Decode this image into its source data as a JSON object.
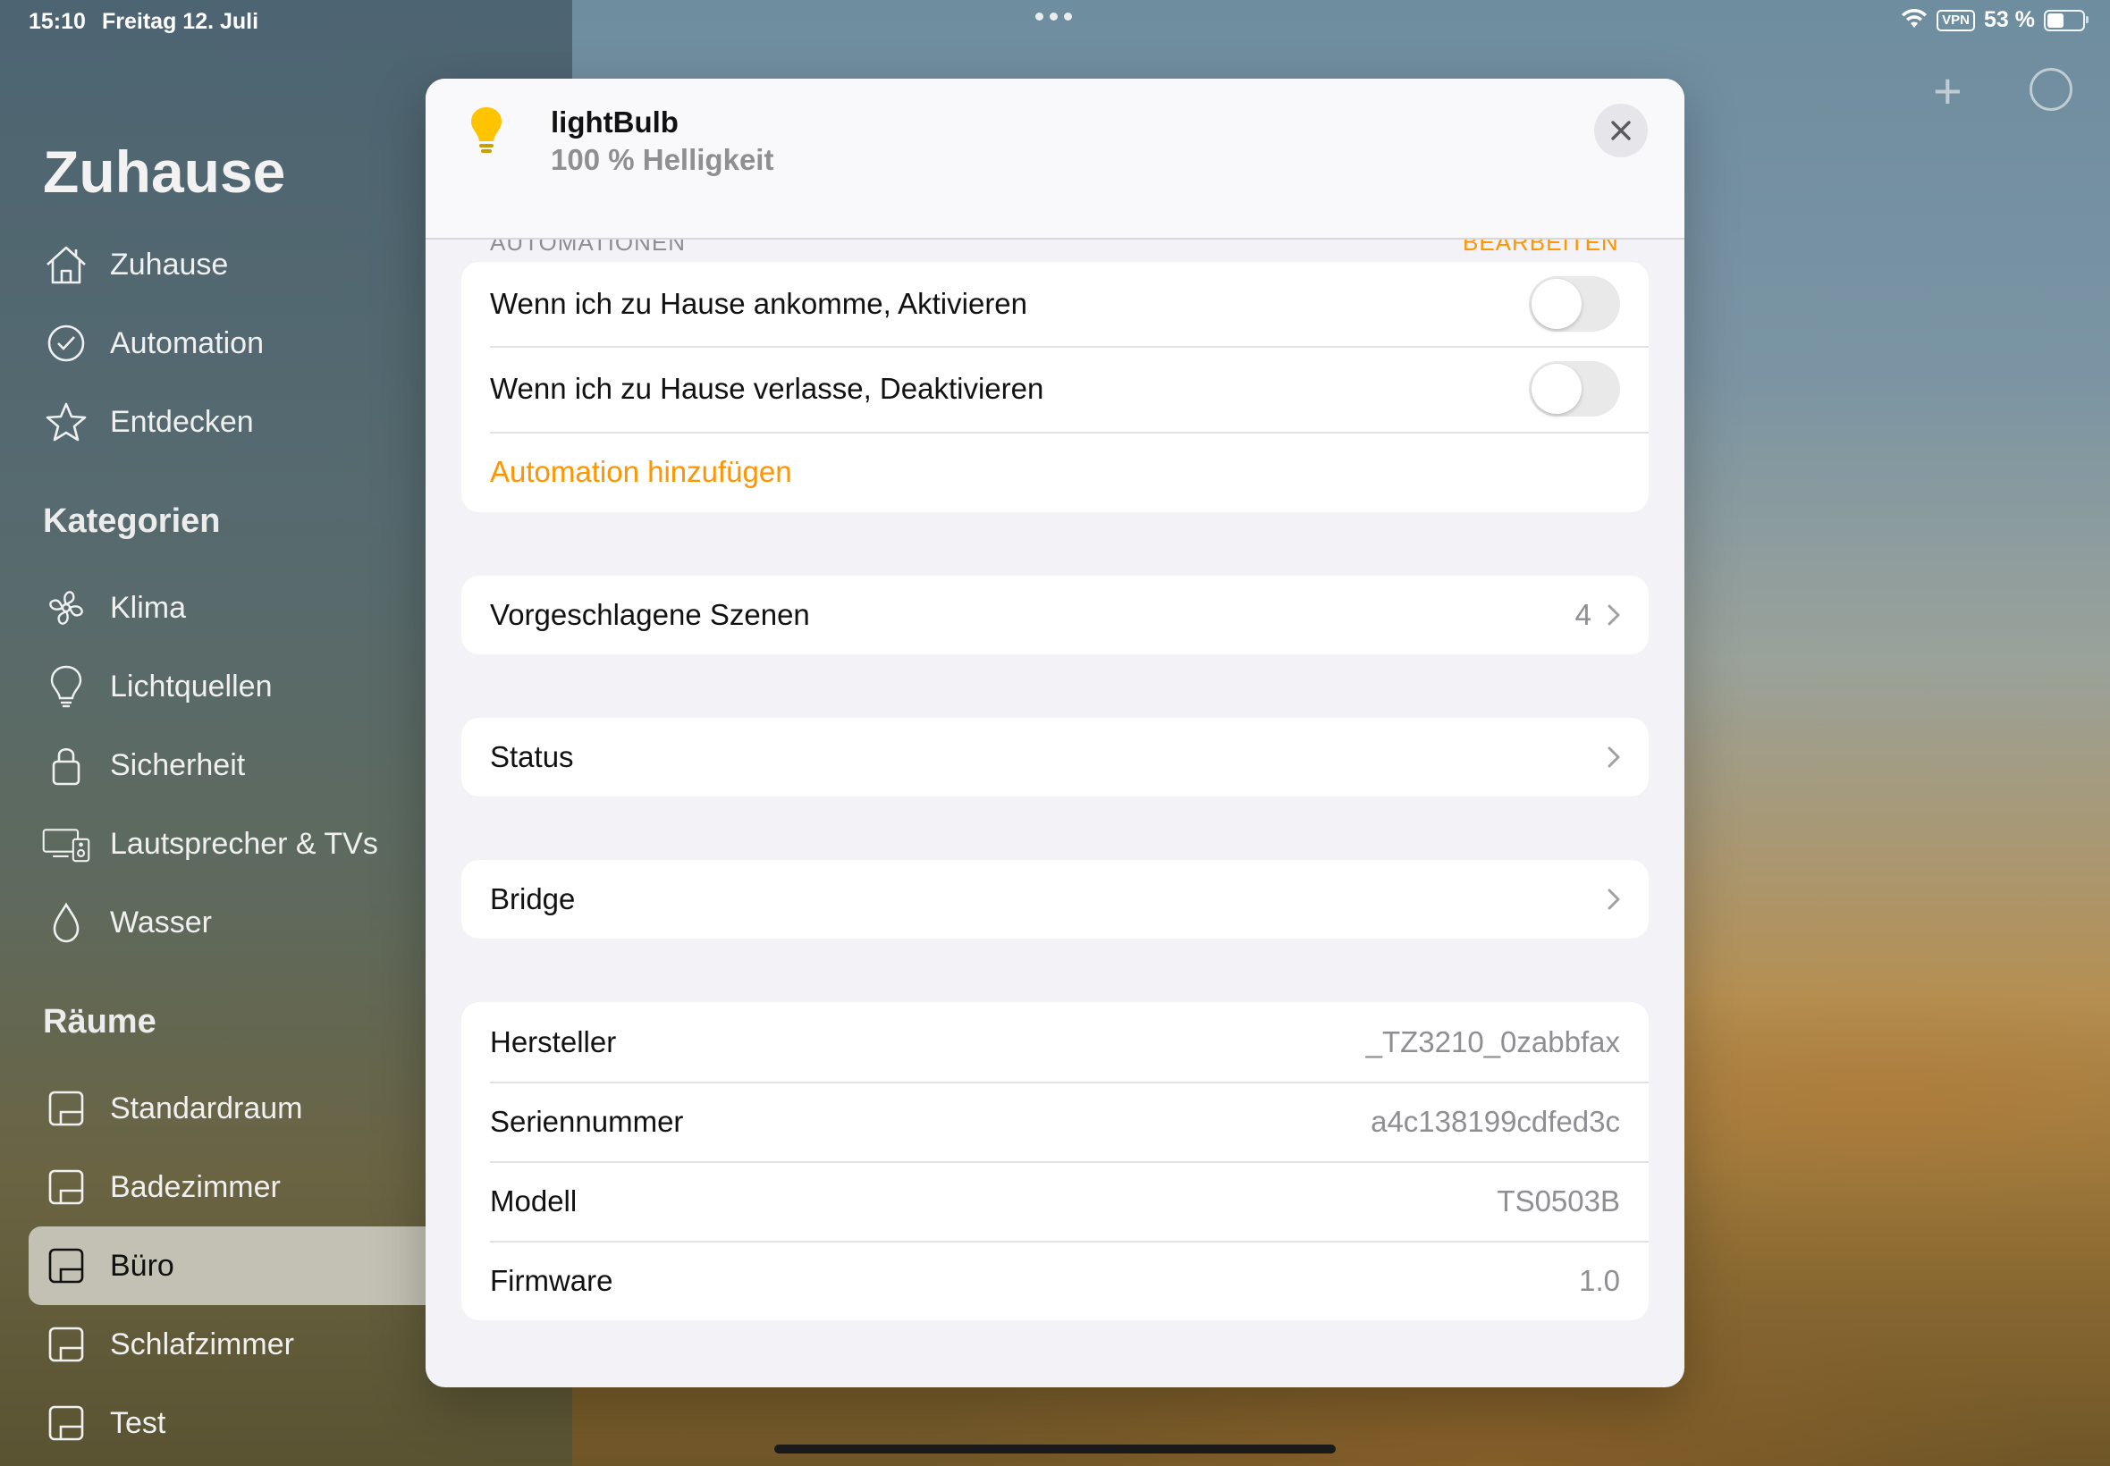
{
  "status_bar": {
    "time": "15:10",
    "date": "Freitag 12. Juli",
    "vpn": "VPN",
    "battery": "53 %",
    "battery_level": 0.53
  },
  "sidebar": {
    "title": "Zuhause",
    "nav": [
      {
        "label": "Zuhause",
        "icon": "house-icon"
      },
      {
        "label": "Automation",
        "icon": "clock-icon"
      },
      {
        "label": "Entdecken",
        "icon": "star-icon"
      }
    ],
    "categories_title": "Kategorien",
    "categories": [
      {
        "label": "Klima",
        "icon": "fan-icon"
      },
      {
        "label": "Lichtquellen",
        "icon": "lightbulb-icon"
      },
      {
        "label": "Sicherheit",
        "icon": "lock-icon"
      },
      {
        "label": "Lautsprecher & TVs",
        "icon": "tv-speaker-icon"
      },
      {
        "label": "Wasser",
        "icon": "drop-icon"
      }
    ],
    "rooms_title": "Räume",
    "rooms": [
      {
        "label": "Standardraum",
        "icon": "room-icon"
      },
      {
        "label": "Badezimmer",
        "icon": "room-icon"
      },
      {
        "label": "Büro",
        "icon": "room-icon",
        "selected": true
      },
      {
        "label": "Schlafzimmer",
        "icon": "room-icon"
      },
      {
        "label": "Test",
        "icon": "room-icon"
      }
    ]
  },
  "modal": {
    "accessory_name": "lightBulb",
    "accessory_status": "100 % Helligkeit",
    "automations_header": "AUTOMATIONEN",
    "automations_edit": "BEARBEITEN",
    "automations": [
      {
        "label": "Wenn ich zu Hause ankomme, Aktivieren",
        "enabled": false
      },
      {
        "label": "Wenn ich zu Hause verlasse, Deaktivieren",
        "enabled": false
      }
    ],
    "add_automation": "Automation hinzufügen",
    "suggested_scenes": {
      "label": "Vorgeschlagene Szenen",
      "count": "4"
    },
    "status_row": "Status",
    "bridge_row": "Bridge",
    "info": [
      {
        "label": "Hersteller",
        "value": "_TZ3210_0zabbfax"
      },
      {
        "label": "Seriennummer",
        "value": "a4c138199cdfed3c"
      },
      {
        "label": "Modell",
        "value": "TS0503B"
      },
      {
        "label": "Firmware",
        "value": "1.0"
      }
    ]
  },
  "colors": {
    "accent": "#ff9500",
    "secondary_text": "#8e8e93",
    "bulb": "#ffc400"
  }
}
